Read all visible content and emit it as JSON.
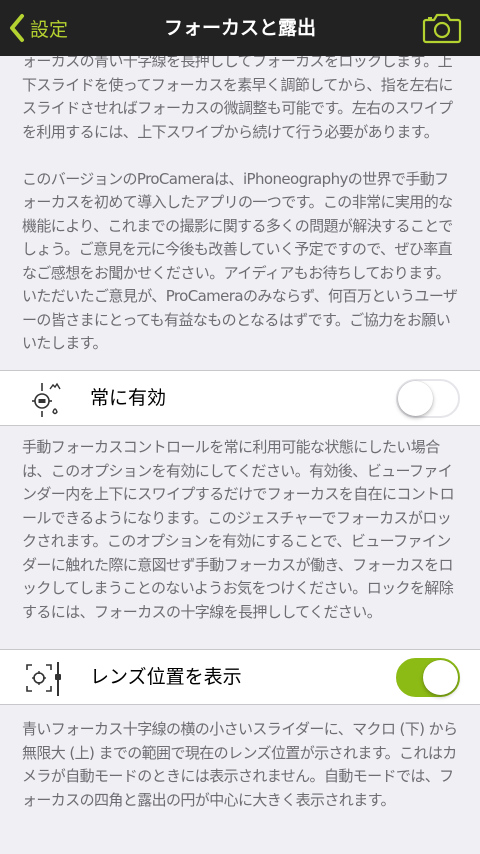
{
  "nav": {
    "back_label": "設定",
    "title": "フォーカスと露出",
    "camera_icon": "camera-icon",
    "accent_color": "#b4d230"
  },
  "intro": {
    "paragraph1": "ォーカスの青い十字線を長押ししてフォーカスをロックします。上下スライドを使ってフォーカスを素早く調節してから、指を左右にスライドさせればフォーカスの微調整も可能です。左右のスワイプを利用するには、上下スワイプから続けて行う必要があります。",
    "paragraph2": "このバージョンのProCameraは、iPhoneographyの世界で手動フォーカスを初めて導入したアプリの一つです。この非常に実用的な機能により、これまでの撮影に関する多くの問題が解決することでしょう。ご意見を元に今後も改善していく予定ですので、ぜひ率直なご感想をお聞かせください。アイディアもお待ちしております。いただいたご意見が、ProCameraのみならず、何百万というユーザーの皆さまにとっても有益なものとなるはずです。ご協力をお願いいたします。"
  },
  "settings": {
    "always_on": {
      "label": "常に有効",
      "icon": "manual-focus-icon",
      "enabled": false,
      "description": "手動フォーカスコントロールを常に利用可能な状態にしたい場合は、このオプションを有効にしてください。有効後、ビューファインダー内を上下にスワイプするだけでフォーカスを自在にコントロールできるようになります。このジェスチャーでフォーカスがロックされます。このオプションを有効にすることで、ビューファインダーに触れた際に意図せず手動フォーカスが働き、フォーカスをロックしてしまうことのないようお気をつけください。ロックを解除するには、フォーカスの十字線を長押ししてください。"
    },
    "lens_position": {
      "label": "レンズ位置を表示",
      "icon": "lens-position-icon",
      "enabled": true,
      "description": "青いフォーカス十字線の横の小さいスライダーに、マクロ (下) から無限大 (上) までの範囲で現在のレンズ位置が示されます。これはカメラが自動モードのときには表示されません。自動モードでは、フォーカスの四角と露出の円が中心に大きく表示されます。"
    }
  },
  "colors": {
    "nav_background": "#222222",
    "toggle_on": "#8dbb15",
    "page_background": "#efeff4"
  }
}
